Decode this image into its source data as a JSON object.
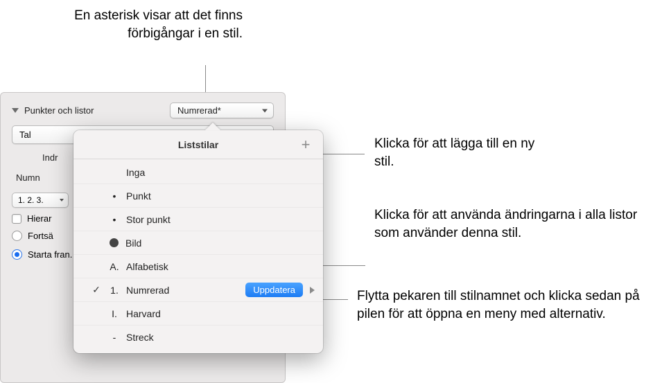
{
  "annotations": {
    "asterisk": "En asterisk visar att det finns förbigångar i en stil.",
    "add": "Klicka för att lägga till en ny stil.",
    "update": "Klicka för att använda ändringarna i alla listor som använder denna stil.",
    "arrow": "Flytta pekaren till stilnamnet och klicka sedan på pilen för att öppna en meny med alternativ."
  },
  "panel": {
    "section_title": "Punkter och listor",
    "list_style_select": "Numrerad*",
    "number_type_select": "Tal",
    "indent_label": "Indr",
    "number_label": "Numn",
    "format_select": "1. 2. 3.",
    "hierarchy_label": "Hierar",
    "continue_label": "Fortsä",
    "start_label": "Starta fran.",
    "stepper_value": ""
  },
  "popover": {
    "title": "Liststilar",
    "update_label": "Uppdatera",
    "items": [
      {
        "label": "Inga",
        "marker": ""
      },
      {
        "label": "Punkt",
        "marker": "•"
      },
      {
        "label": "Stor punkt",
        "marker": "•"
      },
      {
        "label": "Bild",
        "marker": "image"
      },
      {
        "label": "Alfabetisk",
        "marker": "A."
      },
      {
        "label": "Numrerad",
        "marker": "1.",
        "checked": true,
        "update": true
      },
      {
        "label": "Harvard",
        "marker": "I."
      },
      {
        "label": "Streck",
        "marker": "-"
      }
    ]
  }
}
